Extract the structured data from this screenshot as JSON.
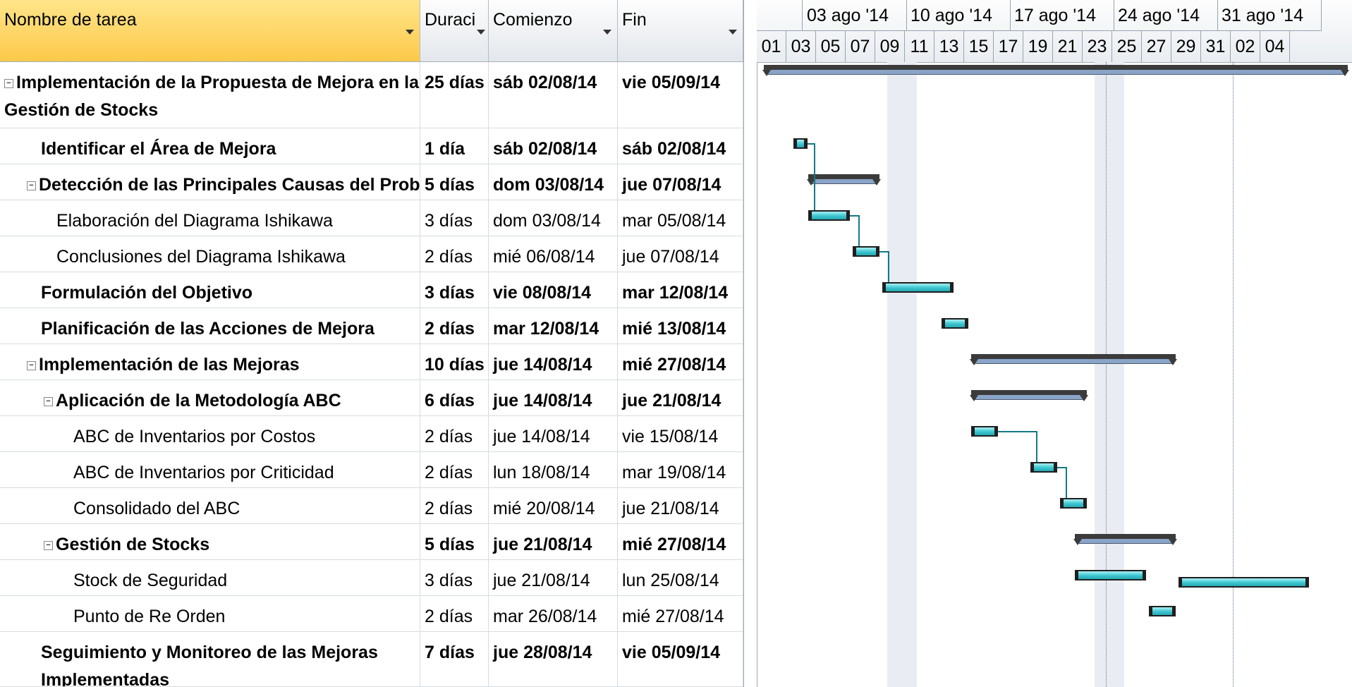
{
  "header": {
    "col_name": "Nombre de tarea",
    "col_duration": "Duraci",
    "col_start": "Comienzo",
    "col_end": "Fin"
  },
  "timeline": {
    "weeks": [
      "03 ago '14",
      "10 ago '14",
      "17 ago '14",
      "24 ago '14",
      "31 ago '14"
    ],
    "days": [
      "01",
      "03",
      "05",
      "07",
      "09",
      "11",
      "13",
      "15",
      "17",
      "19",
      "21",
      "23",
      "25",
      "27",
      "29",
      "31",
      "02",
      "04"
    ]
  },
  "tasks": [
    {
      "name": "Implementación de la Propuesta de Mejora en la Gestión de Stocks",
      "duration": "25 días",
      "start": "sáb 02/08/14",
      "end": "vie 05/09/14",
      "bold": true,
      "summary": true,
      "level": 0
    },
    {
      "name": "Identificar el Área de Mejora",
      "duration": "1 día",
      "start": "sáb 02/08/14",
      "end": "sáb 02/08/14",
      "bold": true,
      "summary": false,
      "level": 1
    },
    {
      "name": "Detección de las Principales Causas del Problem",
      "duration": "5 días",
      "start": "dom 03/08/14",
      "end": "jue 07/08/14",
      "bold": true,
      "summary": true,
      "level": 1
    },
    {
      "name": "Elaboración del Diagrama Ishikawa",
      "duration": "3 días",
      "start": "dom 03/08/14",
      "end": "mar 05/08/14",
      "bold": false,
      "summary": false,
      "level": 2
    },
    {
      "name": "Conclusiones del Diagrama Ishikawa",
      "duration": "2 días",
      "start": "mié 06/08/14",
      "end": "jue 07/08/14",
      "bold": false,
      "summary": false,
      "level": 2
    },
    {
      "name": "Formulación del Objetivo",
      "duration": "3 días",
      "start": "vie 08/08/14",
      "end": "mar 12/08/14",
      "bold": true,
      "summary": false,
      "level": 1
    },
    {
      "name": "Planificación de las Acciones de Mejora",
      "duration": "2 días",
      "start": "mar 12/08/14",
      "end": "mié 13/08/14",
      "bold": true,
      "summary": false,
      "level": 1
    },
    {
      "name": "Implementación de las Mejoras",
      "duration": "10 días",
      "start": "jue 14/08/14",
      "end": "mié 27/08/14",
      "bold": true,
      "summary": true,
      "level": 1
    },
    {
      "name": "Aplicación de la Metodología ABC",
      "duration": "6 días",
      "start": "jue 14/08/14",
      "end": "jue 21/08/14",
      "bold": true,
      "summary": true,
      "level": 2
    },
    {
      "name": "ABC de Inventarios por Costos",
      "duration": "2 días",
      "start": "jue 14/08/14",
      "end": "vie 15/08/14",
      "bold": false,
      "summary": false,
      "level": 3
    },
    {
      "name": "ABC de Inventarios por Criticidad",
      "duration": "2 días",
      "start": "lun 18/08/14",
      "end": "mar 19/08/14",
      "bold": false,
      "summary": false,
      "level": 3
    },
    {
      "name": "Consolidado del ABC",
      "duration": "2 días",
      "start": "mié 20/08/14",
      "end": "jue 21/08/14",
      "bold": false,
      "summary": false,
      "level": 3
    },
    {
      "name": "Gestión de Stocks",
      "duration": "5 días",
      "start": "jue 21/08/14",
      "end": "mié 27/08/14",
      "bold": true,
      "summary": true,
      "level": 2
    },
    {
      "name": "Stock de Seguridad",
      "duration": "3 días",
      "start": "jue 21/08/14",
      "end": "lun 25/08/14",
      "bold": false,
      "summary": false,
      "level": 3
    },
    {
      "name": "Punto de Re Orden",
      "duration": "2 días",
      "start": "mar 26/08/14",
      "end": "mié 27/08/14",
      "bold": false,
      "summary": false,
      "level": 3
    },
    {
      "name": "Seguimiento y Monitoreo de las Mejoras Implementadas",
      "duration": "7 días",
      "start": "jue 28/08/14",
      "end": "vie 05/09/14",
      "bold": true,
      "summary": false,
      "level": 1
    }
  ],
  "colors": {
    "header_selected": "#fcc94a",
    "task_bar": "#3cc6d0",
    "summary_bar": "#3b3b3b",
    "link_arrow": "#147a86"
  }
}
